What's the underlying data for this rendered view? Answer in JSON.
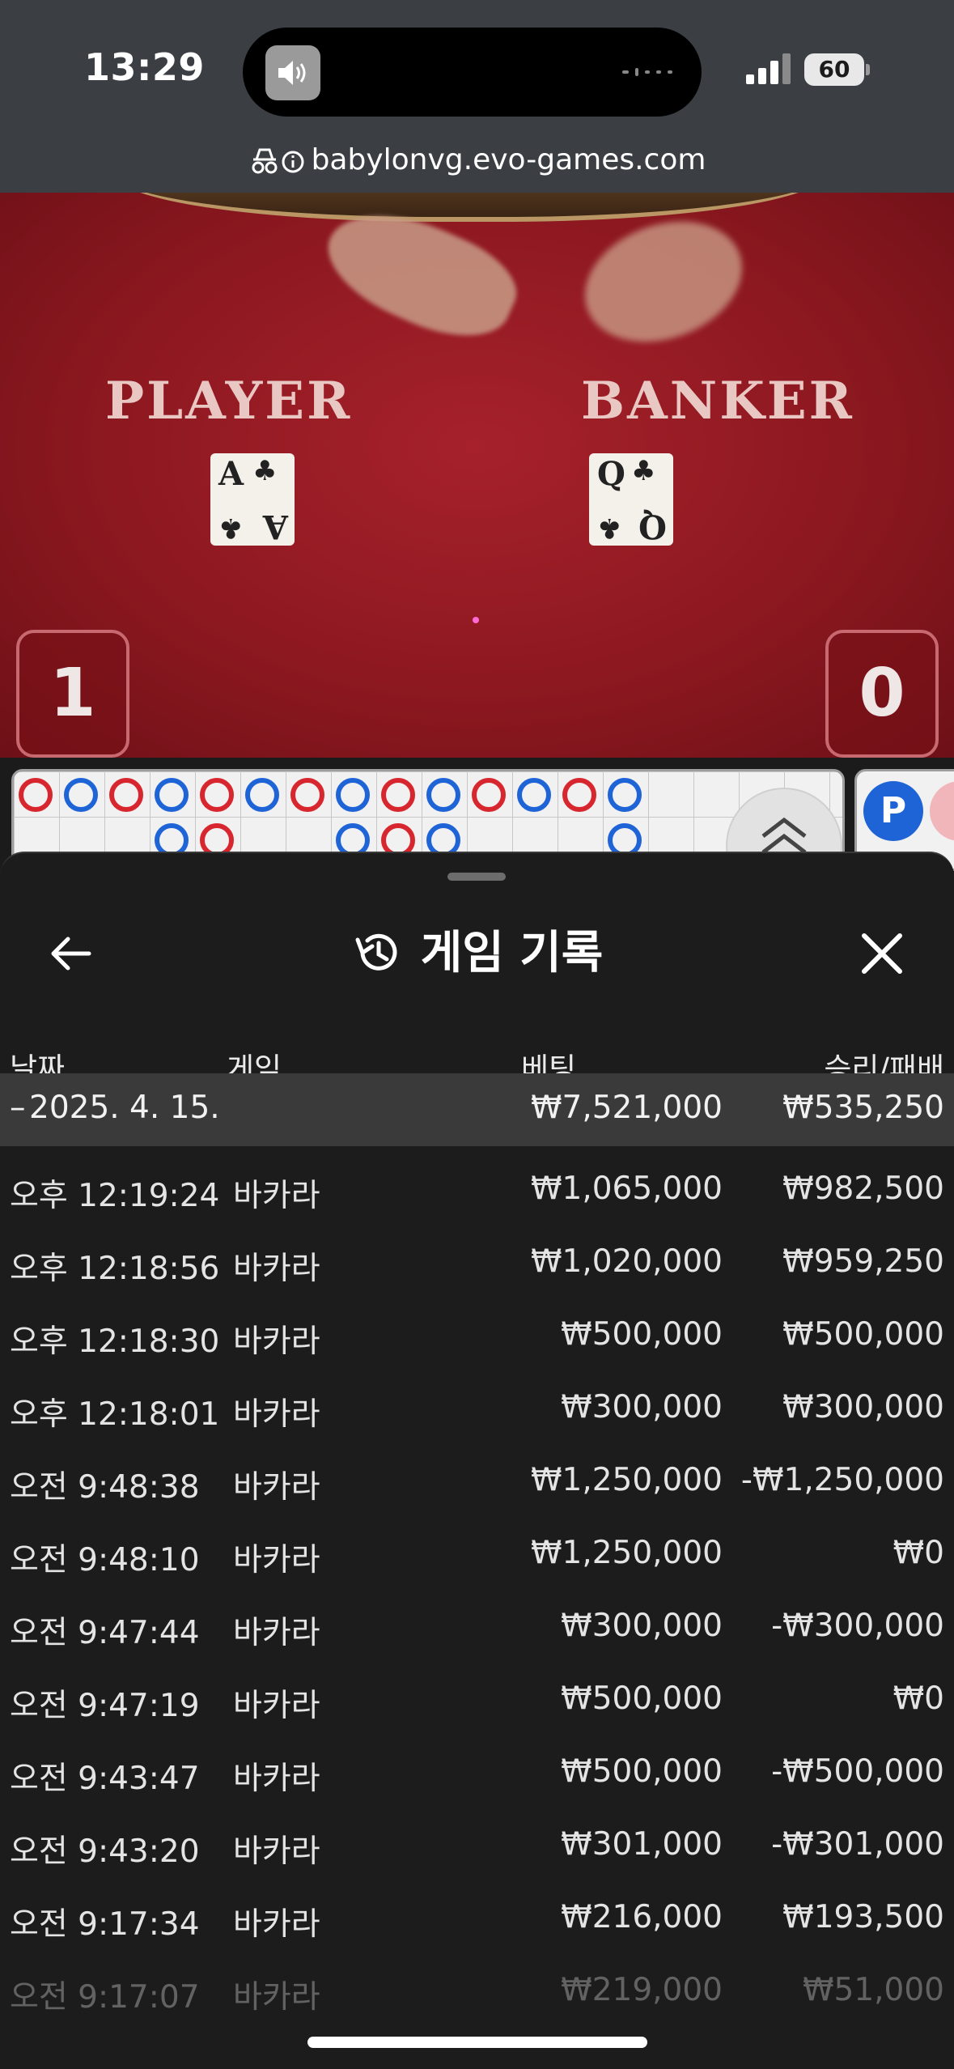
{
  "status_bar": {
    "time": "13:29",
    "battery": "60",
    "url": "babylonvg.evo-games.com"
  },
  "video": {
    "player_label": "PLAYER",
    "banker_label": "BANKER",
    "player_card": {
      "rank": "A",
      "suit": "♣"
    },
    "banker_card": {
      "rank": "Q",
      "suit": "♣"
    },
    "player_score": "1",
    "banker_score": "0"
  },
  "roadmap": {
    "p_badge": "P"
  },
  "history": {
    "title": "게임 기록",
    "columns": {
      "date": "날짜",
      "game": "게임",
      "bet": "베팅",
      "win_loss": "승리/패배"
    },
    "date_group": {
      "toggle": "–",
      "date": "2025. 4. 15.",
      "total_bet": "₩7,521,000",
      "total_win_loss": "₩535,250"
    },
    "rows": [
      {
        "time": "오후 12:19:24",
        "game": "바카라",
        "bet": "₩1,065,000",
        "result": "₩982,500"
      },
      {
        "time": "오후 12:18:56",
        "game": "바카라",
        "bet": "₩1,020,000",
        "result": "₩959,250"
      },
      {
        "time": "오후 12:18:30",
        "game": "바카라",
        "bet": "₩500,000",
        "result": "₩500,000"
      },
      {
        "time": "오후 12:18:01",
        "game": "바카라",
        "bet": "₩300,000",
        "result": "₩300,000"
      },
      {
        "time": "오전 9:48:38",
        "game": "바카라",
        "bet": "₩1,250,000",
        "result": "-₩1,250,000"
      },
      {
        "time": "오전 9:48:10",
        "game": "바카라",
        "bet": "₩1,250,000",
        "result": "₩0"
      },
      {
        "time": "오전 9:47:44",
        "game": "바카라",
        "bet": "₩300,000",
        "result": "-₩300,000"
      },
      {
        "time": "오전 9:47:19",
        "game": "바카라",
        "bet": "₩500,000",
        "result": "₩0"
      },
      {
        "time": "오전 9:43:47",
        "game": "바카라",
        "bet": "₩500,000",
        "result": "-₩500,000"
      },
      {
        "time": "오전 9:43:20",
        "game": "바카라",
        "bet": "₩301,000",
        "result": "-₩301,000"
      },
      {
        "time": "오전 9:17:34",
        "game": "바카라",
        "bet": "₩216,000",
        "result": "₩193,500"
      },
      {
        "time": "오전 9:17:07",
        "game": "바카라",
        "bet": "₩219,000",
        "result": "₩51,000"
      }
    ]
  }
}
